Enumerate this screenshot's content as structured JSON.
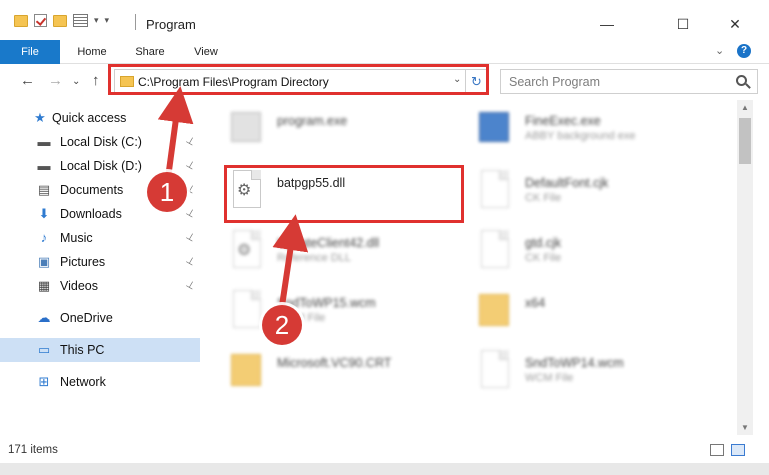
{
  "window": {
    "title": "Program",
    "minimize": "—",
    "maximize": "☐",
    "close": "✕"
  },
  "ribbon": {
    "tabs": [
      "File",
      "Home",
      "Share",
      "View"
    ],
    "help": "?",
    "collapse": "⌄"
  },
  "nav": {
    "back": "←",
    "forward": "→",
    "recent": "⌄",
    "up": "↑",
    "address": "C:\\Program Files\\Program Directory",
    "refresh": "↻",
    "search_placeholder": "Search Program"
  },
  "sidebar": {
    "items": [
      {
        "label": "Quick access",
        "icon": "star-icon",
        "glyph": "★",
        "color": "#2f7bd0"
      },
      {
        "label": "Local Disk (C:)",
        "icon": "drive-icon",
        "glyph": "▬",
        "color": "#555555",
        "pinned": true
      },
      {
        "label": "Local Disk (D:)",
        "icon": "drive-icon",
        "glyph": "▬",
        "color": "#555555",
        "pinned": true
      },
      {
        "label": "Documents",
        "icon": "documents-icon",
        "glyph": "▤",
        "color": "#555555",
        "pinned": true
      },
      {
        "label": "Downloads",
        "icon": "download-icon",
        "glyph": "⬇",
        "color": "#2f7bd0",
        "pinned": true
      },
      {
        "label": "Music",
        "icon": "music-icon",
        "glyph": "♪",
        "color": "#2f7bd0",
        "pinned": true
      },
      {
        "label": "Pictures",
        "icon": "pictures-icon",
        "glyph": "▣",
        "color": "#4a7eb8",
        "pinned": true
      },
      {
        "label": "Videos",
        "icon": "videos-icon",
        "glyph": "▦",
        "color": "#444444",
        "pinned": true
      },
      {
        "label": "OneDrive",
        "icon": "cloud-icon",
        "glyph": "☁",
        "color": "#2a6fc9"
      },
      {
        "label": "This PC",
        "icon": "computer-icon",
        "glyph": "▭",
        "color": "#2f7bd0",
        "active": true
      },
      {
        "label": "Network",
        "icon": "network-icon",
        "glyph": "⊞",
        "color": "#2f7bd0"
      }
    ],
    "pin_glyph": "📌"
  },
  "files": [
    {
      "name": "program.exe",
      "type": "",
      "icon": "exe-icon"
    },
    {
      "name": "FineExec.exe",
      "type": "ABBY background exe",
      "icon": "exe-icon"
    },
    {
      "name": "batpgp55.dll",
      "type": "",
      "icon": "dll-gear-icon",
      "highlighted": true
    },
    {
      "name": "DefaultFont.cjk",
      "type": "CK File",
      "icon": "document-icon"
    },
    {
      "name": "UpdateClient42.dll",
      "type": "Reference DLL",
      "icon": "dll-gear-icon"
    },
    {
      "name": "gtd.cjk",
      "type": "CK File",
      "icon": "document-icon"
    },
    {
      "name": "SndToWP15.wcm",
      "type": "WCM File",
      "icon": "document-icon"
    },
    {
      "name": "x64",
      "type": "",
      "icon": "folder-icon"
    },
    {
      "name": "Microsoft.VC90.CRT",
      "type": "",
      "icon": "folder-icon"
    },
    {
      "name": "SndToWP14.wcm",
      "type": "WCM File",
      "icon": "document-icon"
    }
  ],
  "status": {
    "item_count": "171 items"
  },
  "annotations": [
    {
      "number": "1"
    },
    {
      "number": "2"
    }
  ],
  "colors": {
    "highlight": "#e0312e",
    "file_tab": "#1979ca",
    "badge": "#d63a35"
  }
}
